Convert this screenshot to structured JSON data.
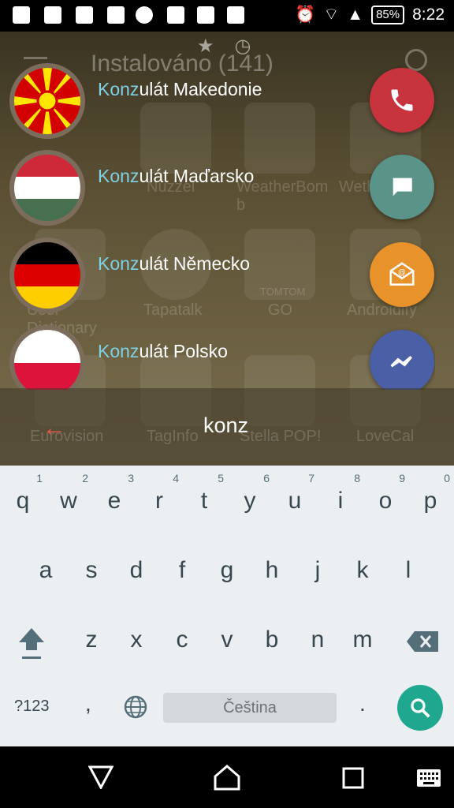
{
  "status_bar": {
    "battery": "85%",
    "time": "8:22"
  },
  "home_background": {
    "title": "Instalováno (141)",
    "app_labels": [
      "Nuzzel",
      "WeatherBom b",
      "Weth",
      "User Dictionary",
      "Tapatalk",
      "GO",
      "Androidify",
      "Eurovision",
      "TagInfo",
      "Stella POP!",
      "LoveCal"
    ],
    "tomtom_label": "TOMTOM"
  },
  "contacts": [
    {
      "highlight": "Konz",
      "rest": "ulát Makedonie",
      "flag": "macedonia",
      "action": "phone-icon",
      "action_color": "#c8343d"
    },
    {
      "highlight": "Konz",
      "rest": "ulát Maďarsko",
      "flag": "hungary",
      "action": "message-icon",
      "action_color": "#5a9489"
    },
    {
      "highlight": "Konz",
      "rest": "ulát Německo",
      "flag": "germany",
      "action": "email-icon",
      "action_color": "#e8922b"
    },
    {
      "highlight": "Konz",
      "rest": "ulát Polsko",
      "flag": "poland",
      "action": "messenger-icon",
      "action_color": "#4a5fa6"
    }
  ],
  "search": {
    "query": "konz"
  },
  "keyboard": {
    "row1": [
      "q",
      "w",
      "e",
      "r",
      "t",
      "y",
      "u",
      "i",
      "o",
      "p"
    ],
    "row1_nums": [
      "1",
      "2",
      "3",
      "4",
      "5",
      "6",
      "7",
      "8",
      "9",
      "0"
    ],
    "row2": [
      "a",
      "s",
      "d",
      "f",
      "g",
      "h",
      "j",
      "k",
      "l"
    ],
    "row3": [
      "z",
      "x",
      "c",
      "v",
      "b",
      "n",
      "m"
    ],
    "symbols_label": "?123",
    "comma": ",",
    "period": ".",
    "space_label": "Čeština"
  }
}
